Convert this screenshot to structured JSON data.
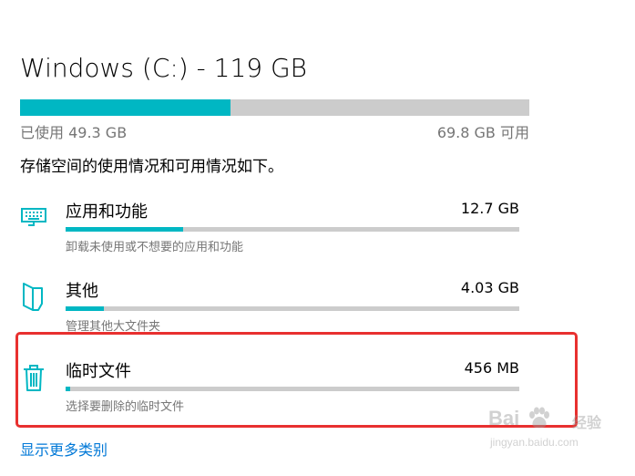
{
  "drive": {
    "title": "Windows (C:) - 119 GB",
    "used_label": "已使用 49.3 GB",
    "free_label": "69.8 GB 可用",
    "used_fraction": 0.414,
    "summary": "存储空间的使用情况和可用情况如下。"
  },
  "categories": [
    {
      "name": "应用和功能",
      "size": "12.7 GB",
      "desc": "卸载未使用或不想要的应用和功能",
      "fill_fraction": 0.26,
      "icon": "keyboard-icon"
    },
    {
      "name": "其他",
      "size": "4.03 GB",
      "desc": "管理其他大文件夹",
      "fill_fraction": 0.085,
      "icon": "folder-page-icon"
    },
    {
      "name": "临时文件",
      "size": "456 MB",
      "desc": "选择要删除的临时文件",
      "fill_fraction": 0.01,
      "icon": "trash-icon"
    }
  ],
  "more_link": "显示更多类别",
  "colors": {
    "accent": "#00b7c3",
    "track": "#cccccc",
    "link": "#0078d7",
    "highlight": "#e8302f",
    "muted": "#767676"
  },
  "watermark": {
    "brand": "Bai",
    "sub": "经验",
    "url": "jingyan.baidu.com"
  }
}
